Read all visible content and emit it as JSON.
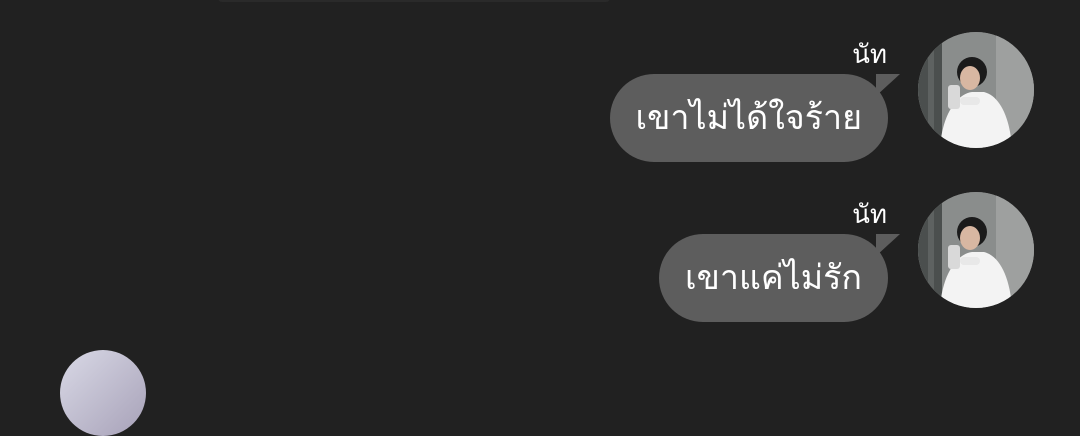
{
  "messages": [
    {
      "sender": "นัท",
      "text": "เขาไม่ได้ใจร้าย"
    },
    {
      "sender": "นัท",
      "text": "เขาแค่ไม่รัก"
    }
  ],
  "colors": {
    "background": "#212121",
    "bubble": "#5d5d5d",
    "text": "#ffffff"
  }
}
